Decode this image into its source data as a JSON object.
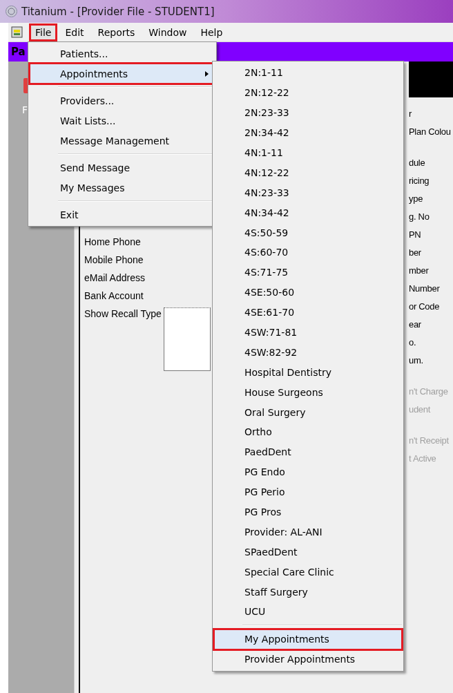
{
  "window": {
    "title": "Titanium - [Provider File - STUDENT1]"
  },
  "menu_bar": [
    {
      "label": "File",
      "open": true,
      "highlighted": true
    },
    {
      "label": "Edit",
      "open": false,
      "highlighted": false
    },
    {
      "label": "Reports",
      "open": false,
      "highlighted": false
    },
    {
      "label": "Window",
      "open": false,
      "highlighted": false
    },
    {
      "label": "Help",
      "open": false,
      "highlighted": false
    }
  ],
  "document_tab": {
    "label": "Pa"
  },
  "sidebar": {
    "button_label": "F"
  },
  "form": {
    "left_labels": [
      "Home Phone",
      "Mobile Phone",
      "eMail Address",
      "Bank Account",
      "Show Recall Type"
    ],
    "right_label_groups": [
      [
        {
          "label": "r",
          "disabled": false
        },
        {
          "label": "Plan Colou",
          "disabled": false
        }
      ],
      [
        {
          "label": "dule",
          "disabled": false
        },
        {
          "label": "ricing",
          "disabled": false
        },
        {
          "label": "ype",
          "disabled": false
        },
        {
          "label": "g. No",
          "disabled": false
        },
        {
          "label": "PN",
          "disabled": false
        },
        {
          "label": "ber",
          "disabled": false
        },
        {
          "label": "mber",
          "disabled": false
        },
        {
          "label": "Number",
          "disabled": false
        },
        {
          "label": "or Code",
          "disabled": false
        },
        {
          "label": "ear",
          "disabled": false
        },
        {
          "label": "o.",
          "disabled": false
        },
        {
          "label": "um.",
          "disabled": false
        }
      ],
      [
        {
          "label": "n't Charge",
          "disabled": true
        },
        {
          "label": "udent",
          "disabled": true
        }
      ],
      [
        {
          "label": "n't Receipt",
          "disabled": true
        },
        {
          "label": "t Active",
          "disabled": true
        }
      ]
    ]
  },
  "file_menu": [
    {
      "kind": "item",
      "label": "Patients...",
      "selected": false,
      "highlighted": false,
      "submenu": false
    },
    {
      "kind": "item",
      "label": "Appointments",
      "selected": true,
      "highlighted": true,
      "submenu": true
    },
    {
      "kind": "separator"
    },
    {
      "kind": "item",
      "label": "Providers...",
      "selected": false,
      "highlighted": false,
      "submenu": false
    },
    {
      "kind": "item",
      "label": "Wait Lists...",
      "selected": false,
      "highlighted": false,
      "submenu": false
    },
    {
      "kind": "item",
      "label": "Message Management",
      "selected": false,
      "highlighted": false,
      "submenu": false
    },
    {
      "kind": "separator"
    },
    {
      "kind": "item",
      "label": "Send Message",
      "selected": false,
      "highlighted": false,
      "submenu": false
    },
    {
      "kind": "item",
      "label": "My Messages",
      "selected": false,
      "highlighted": false,
      "submenu": false
    },
    {
      "kind": "separator"
    },
    {
      "kind": "item",
      "label": "Exit",
      "selected": false,
      "highlighted": false,
      "submenu": false
    }
  ],
  "appointments_submenu": [
    {
      "kind": "item",
      "label": "2N:1-11",
      "selected": false,
      "highlighted": false
    },
    {
      "kind": "item",
      "label": "2N:12-22",
      "selected": false,
      "highlighted": false
    },
    {
      "kind": "item",
      "label": "2N:23-33",
      "selected": false,
      "highlighted": false
    },
    {
      "kind": "item",
      "label": "2N:34-42",
      "selected": false,
      "highlighted": false
    },
    {
      "kind": "item",
      "label": "4N:1-11",
      "selected": false,
      "highlighted": false
    },
    {
      "kind": "item",
      "label": "4N:12-22",
      "selected": false,
      "highlighted": false
    },
    {
      "kind": "item",
      "label": "4N:23-33",
      "selected": false,
      "highlighted": false
    },
    {
      "kind": "item",
      "label": "4N:34-42",
      "selected": false,
      "highlighted": false
    },
    {
      "kind": "item",
      "label": "4S:50-59",
      "selected": false,
      "highlighted": false
    },
    {
      "kind": "item",
      "label": "4S:60-70",
      "selected": false,
      "highlighted": false
    },
    {
      "kind": "item",
      "label": "4S:71-75",
      "selected": false,
      "highlighted": false
    },
    {
      "kind": "item",
      "label": "4SE:50-60",
      "selected": false,
      "highlighted": false
    },
    {
      "kind": "item",
      "label": "4SE:61-70",
      "selected": false,
      "highlighted": false
    },
    {
      "kind": "item",
      "label": "4SW:71-81",
      "selected": false,
      "highlighted": false
    },
    {
      "kind": "item",
      "label": "4SW:82-92",
      "selected": false,
      "highlighted": false
    },
    {
      "kind": "item",
      "label": "Hospital Dentistry",
      "selected": false,
      "highlighted": false
    },
    {
      "kind": "item",
      "label": "House Surgeons",
      "selected": false,
      "highlighted": false
    },
    {
      "kind": "item",
      "label": "Oral Surgery",
      "selected": false,
      "highlighted": false
    },
    {
      "kind": "item",
      "label": "Ortho",
      "selected": false,
      "highlighted": false
    },
    {
      "kind": "item",
      "label": "PaedDent",
      "selected": false,
      "highlighted": false
    },
    {
      "kind": "item",
      "label": "PG Endo",
      "selected": false,
      "highlighted": false
    },
    {
      "kind": "item",
      "label": "PG Perio",
      "selected": false,
      "highlighted": false
    },
    {
      "kind": "item",
      "label": "PG Pros",
      "selected": false,
      "highlighted": false
    },
    {
      "kind": "item",
      "label": "Provider: AL-ANI",
      "selected": false,
      "highlighted": false
    },
    {
      "kind": "item",
      "label": "SPaedDent",
      "selected": false,
      "highlighted": false
    },
    {
      "kind": "item",
      "label": "Special Care Clinic",
      "selected": false,
      "highlighted": false
    },
    {
      "kind": "item",
      "label": "Staff Surgery",
      "selected": false,
      "highlighted": false
    },
    {
      "kind": "item",
      "label": "UCU",
      "selected": false,
      "highlighted": false
    },
    {
      "kind": "separator"
    },
    {
      "kind": "item",
      "label": "My Appointments",
      "selected": true,
      "highlighted": true
    },
    {
      "kind": "item",
      "label": "Provider Appointments",
      "selected": false,
      "highlighted": false
    }
  ]
}
